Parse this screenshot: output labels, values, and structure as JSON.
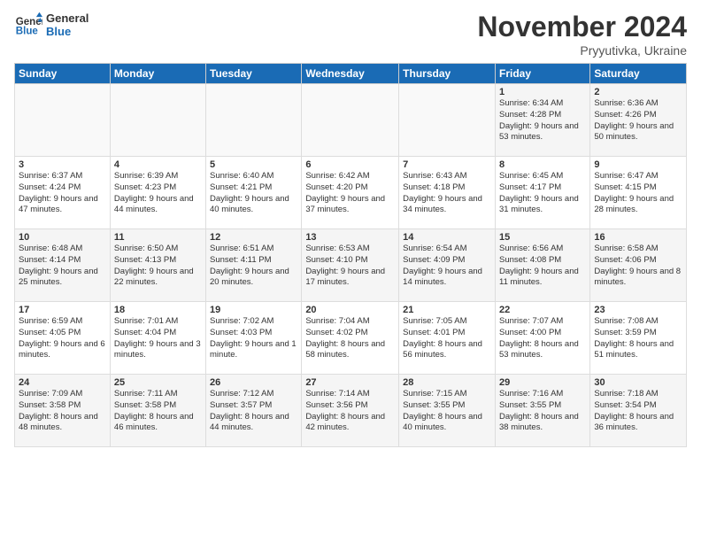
{
  "logo": {
    "line1": "General",
    "line2": "Blue"
  },
  "title": "November 2024",
  "location": "Pryyutivka, Ukraine",
  "weekdays": [
    "Sunday",
    "Monday",
    "Tuesday",
    "Wednesday",
    "Thursday",
    "Friday",
    "Saturday"
  ],
  "weeks": [
    [
      {
        "day": "",
        "info": ""
      },
      {
        "day": "",
        "info": ""
      },
      {
        "day": "",
        "info": ""
      },
      {
        "day": "",
        "info": ""
      },
      {
        "day": "",
        "info": ""
      },
      {
        "day": "1",
        "info": "Sunrise: 6:34 AM\nSunset: 4:28 PM\nDaylight: 9 hours\nand 53 minutes."
      },
      {
        "day": "2",
        "info": "Sunrise: 6:36 AM\nSunset: 4:26 PM\nDaylight: 9 hours\nand 50 minutes."
      }
    ],
    [
      {
        "day": "3",
        "info": "Sunrise: 6:37 AM\nSunset: 4:24 PM\nDaylight: 9 hours\nand 47 minutes."
      },
      {
        "day": "4",
        "info": "Sunrise: 6:39 AM\nSunset: 4:23 PM\nDaylight: 9 hours\nand 44 minutes."
      },
      {
        "day": "5",
        "info": "Sunrise: 6:40 AM\nSunset: 4:21 PM\nDaylight: 9 hours\nand 40 minutes."
      },
      {
        "day": "6",
        "info": "Sunrise: 6:42 AM\nSunset: 4:20 PM\nDaylight: 9 hours\nand 37 minutes."
      },
      {
        "day": "7",
        "info": "Sunrise: 6:43 AM\nSunset: 4:18 PM\nDaylight: 9 hours\nand 34 minutes."
      },
      {
        "day": "8",
        "info": "Sunrise: 6:45 AM\nSunset: 4:17 PM\nDaylight: 9 hours\nand 31 minutes."
      },
      {
        "day": "9",
        "info": "Sunrise: 6:47 AM\nSunset: 4:15 PM\nDaylight: 9 hours\nand 28 minutes."
      }
    ],
    [
      {
        "day": "10",
        "info": "Sunrise: 6:48 AM\nSunset: 4:14 PM\nDaylight: 9 hours\nand 25 minutes."
      },
      {
        "day": "11",
        "info": "Sunrise: 6:50 AM\nSunset: 4:13 PM\nDaylight: 9 hours\nand 22 minutes."
      },
      {
        "day": "12",
        "info": "Sunrise: 6:51 AM\nSunset: 4:11 PM\nDaylight: 9 hours\nand 20 minutes."
      },
      {
        "day": "13",
        "info": "Sunrise: 6:53 AM\nSunset: 4:10 PM\nDaylight: 9 hours\nand 17 minutes."
      },
      {
        "day": "14",
        "info": "Sunrise: 6:54 AM\nSunset: 4:09 PM\nDaylight: 9 hours\nand 14 minutes."
      },
      {
        "day": "15",
        "info": "Sunrise: 6:56 AM\nSunset: 4:08 PM\nDaylight: 9 hours\nand 11 minutes."
      },
      {
        "day": "16",
        "info": "Sunrise: 6:58 AM\nSunset: 4:06 PM\nDaylight: 9 hours\nand 8 minutes."
      }
    ],
    [
      {
        "day": "17",
        "info": "Sunrise: 6:59 AM\nSunset: 4:05 PM\nDaylight: 9 hours\nand 6 minutes."
      },
      {
        "day": "18",
        "info": "Sunrise: 7:01 AM\nSunset: 4:04 PM\nDaylight: 9 hours\nand 3 minutes."
      },
      {
        "day": "19",
        "info": "Sunrise: 7:02 AM\nSunset: 4:03 PM\nDaylight: 9 hours\nand 1 minute."
      },
      {
        "day": "20",
        "info": "Sunrise: 7:04 AM\nSunset: 4:02 PM\nDaylight: 8 hours\nand 58 minutes."
      },
      {
        "day": "21",
        "info": "Sunrise: 7:05 AM\nSunset: 4:01 PM\nDaylight: 8 hours\nand 56 minutes."
      },
      {
        "day": "22",
        "info": "Sunrise: 7:07 AM\nSunset: 4:00 PM\nDaylight: 8 hours\nand 53 minutes."
      },
      {
        "day": "23",
        "info": "Sunrise: 7:08 AM\nSunset: 3:59 PM\nDaylight: 8 hours\nand 51 minutes."
      }
    ],
    [
      {
        "day": "24",
        "info": "Sunrise: 7:09 AM\nSunset: 3:58 PM\nDaylight: 8 hours\nand 48 minutes."
      },
      {
        "day": "25",
        "info": "Sunrise: 7:11 AM\nSunset: 3:58 PM\nDaylight: 8 hours\nand 46 minutes."
      },
      {
        "day": "26",
        "info": "Sunrise: 7:12 AM\nSunset: 3:57 PM\nDaylight: 8 hours\nand 44 minutes."
      },
      {
        "day": "27",
        "info": "Sunrise: 7:14 AM\nSunset: 3:56 PM\nDaylight: 8 hours\nand 42 minutes."
      },
      {
        "day": "28",
        "info": "Sunrise: 7:15 AM\nSunset: 3:55 PM\nDaylight: 8 hours\nand 40 minutes."
      },
      {
        "day": "29",
        "info": "Sunrise: 7:16 AM\nSunset: 3:55 PM\nDaylight: 8 hours\nand 38 minutes."
      },
      {
        "day": "30",
        "info": "Sunrise: 7:18 AM\nSunset: 3:54 PM\nDaylight: 8 hours\nand 36 minutes."
      }
    ]
  ]
}
